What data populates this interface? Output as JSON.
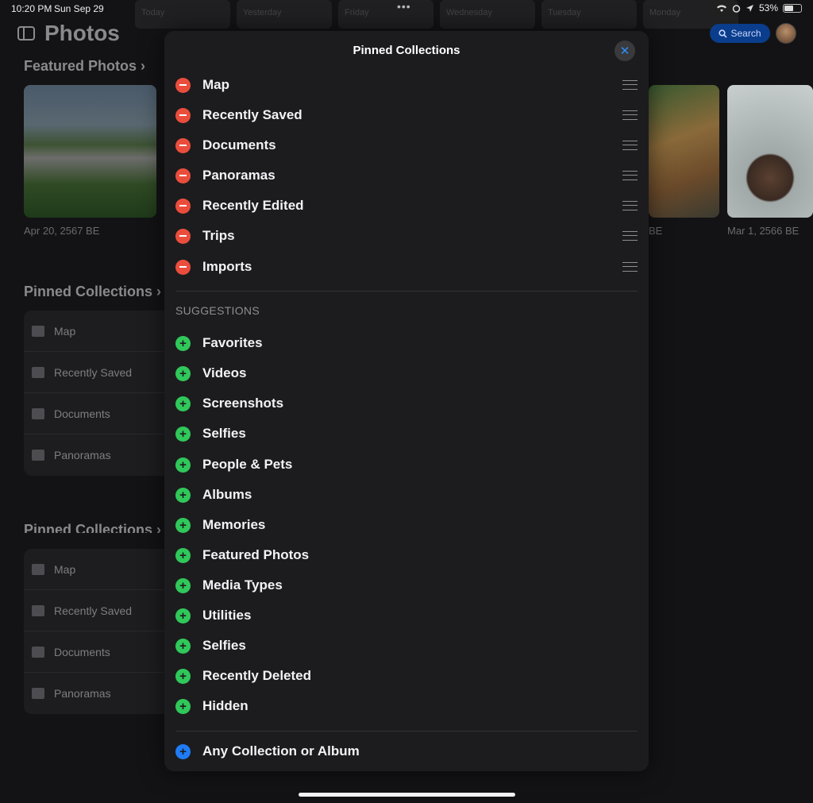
{
  "status": {
    "time": "10:20 PM",
    "date": "Sun Sep 29",
    "battery": "53%",
    "battery_level": 0.53
  },
  "top_strip": [
    "Today",
    "Yesterday",
    "Friday",
    "Wednesday",
    "Tuesday",
    "Monday"
  ],
  "header": {
    "title": "Photos",
    "search_label": "Search"
  },
  "background": {
    "featured_title": "Featured Photos",
    "featured_dates": [
      "Apr 20, 2567 BE",
      "BE",
      "Mar 1, 2566 BE"
    ],
    "pinned_title": "Pinned Collections",
    "pinned_items": [
      "Map",
      "Recently Saved",
      "Documents",
      "Panoramas"
    ]
  },
  "modal": {
    "title": "Pinned Collections",
    "pinned": [
      "Map",
      "Recently Saved",
      "Documents",
      "Panoramas",
      "Recently Edited",
      "Trips",
      "Imports"
    ],
    "suggestions_header": "SUGGESTIONS",
    "suggestions": [
      "Favorites",
      "Videos",
      "Screenshots",
      "Selfies",
      "People & Pets",
      "Albums",
      "Memories",
      "Featured Photos",
      "Media Types",
      "Utilities",
      "Selfies",
      "Recently Deleted",
      "Hidden"
    ],
    "any_collection": "Any Collection or Album"
  },
  "colors": {
    "remove": "#eb4d3d",
    "add": "#30c85a",
    "accent": "#1f7cf6"
  }
}
